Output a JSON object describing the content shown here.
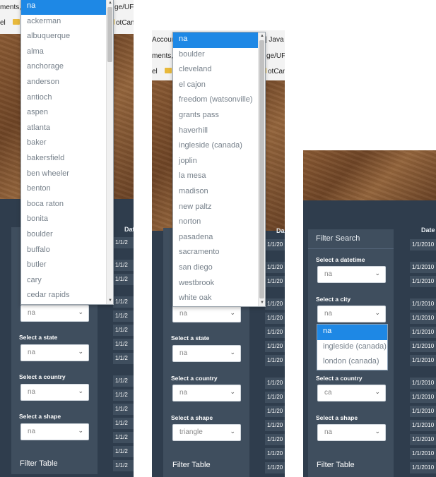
{
  "panel1": {
    "chrome_row1": "ments,",
    "chrome_row1_right": "ge/UF",
    "chrome_row2_left": "el",
    "chrome_row2_right": "otCamp",
    "date_header": "Dat",
    "dates": [
      "1/1/2",
      "1/1/2",
      "1/1/2",
      "1/1/2",
      "1/1/2",
      "1/1/2",
      "1/1/2",
      "1/1/2",
      "1/1/2",
      "1/1/2",
      "1/1/2",
      "1/1/2",
      "1/1/2",
      "1/1/2",
      "1/1/2",
      "1/1/2"
    ],
    "labels": {
      "state": "Select a state",
      "country": "Select a country",
      "shape": "Select a shape"
    },
    "values": {
      "city": "na",
      "state": "na",
      "country": "na",
      "shape": "na"
    },
    "filter_table": "Filter Table",
    "city_options": [
      "na",
      "ackerman",
      "albuquerque",
      "alma",
      "anchorage",
      "anderson",
      "antioch",
      "aspen",
      "atlanta",
      "baker",
      "bakersfield",
      "ben wheeler",
      "benton",
      "boca raton",
      "bonita",
      "boulder",
      "buffalo",
      "butler",
      "cary",
      "cedar rapids"
    ]
  },
  "panel2": {
    "chrome_row1": "Accoun",
    "chrome_row1_right": "| Java",
    "chrome_row2": "ments,",
    "chrome_row2_right": "ge/UF",
    "chrome_row3_left": "el",
    "chrome_row3_right": "otCamp",
    "date_header": "Da",
    "dates": [
      "1/1/20",
      "1/1/20",
      "1/1/20",
      "1/1/20",
      "1/1/20",
      "1/1/20",
      "1/1/20",
      "1/1/20",
      "1/1/20",
      "1/1/20",
      "1/1/20",
      "1/1/20",
      "1/1/20",
      "1/1/20",
      "1/1/20",
      "1/1/20"
    ],
    "labels": {
      "state": "Select a state",
      "country": "Select a country",
      "shape": "Select a shape"
    },
    "values": {
      "city": "na",
      "state": "na",
      "country": "na",
      "shape": "triangle"
    },
    "filter_table": "Filter Table",
    "city_options": [
      "na",
      "boulder",
      "cleveland",
      "el cajon",
      "freedom (watsonville)",
      "grants pass",
      "haverhill",
      "ingleside (canada)",
      "joplin",
      "la mesa",
      "madison",
      "new paltz",
      "norton",
      "pasadena",
      "sacramento",
      "san diego",
      "westbrook",
      "white oak"
    ]
  },
  "panel3": {
    "filter_search": "Filter Search",
    "date_header": "Date",
    "dates": [
      "1/1/2010",
      "1/1/2010",
      "1/1/2010",
      "1/1/2010",
      "1/1/2010",
      "1/1/2010",
      "1/1/2010",
      "1/1/2010",
      "1/1/2010",
      "1/1/2010",
      "1/1/2010",
      "1/1/2010",
      "1/1/2010",
      "1/1/2010",
      "1/1/2010",
      "1/1/2010"
    ],
    "labels": {
      "datetime": "Select a datetime",
      "city": "Select a city",
      "country": "Select a country",
      "shape": "Select a shape"
    },
    "values": {
      "datetime": "na",
      "city": "na",
      "country": "ca",
      "shape": "na"
    },
    "filter_table": "Filter Table",
    "city_options": [
      "na",
      "ingleside (canada)",
      "london (canada)"
    ]
  },
  "colors": {
    "highlight": "#1e88e5",
    "sidebar": "#3f4e5e",
    "dark_bg": "#2f3d4d"
  }
}
